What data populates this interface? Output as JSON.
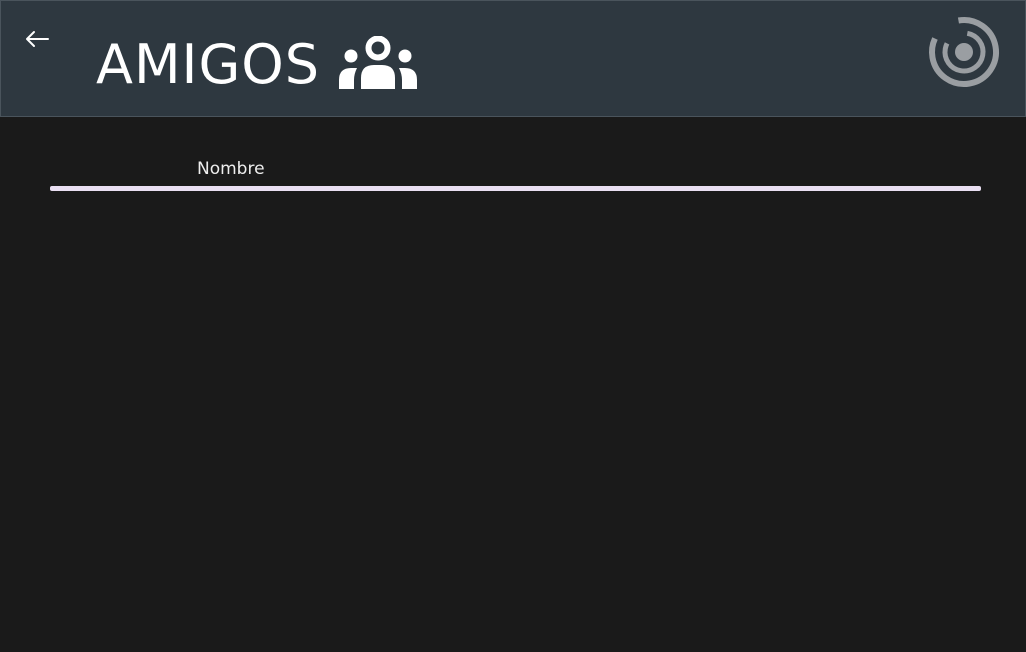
{
  "header": {
    "back_icon": "arrow-left-icon",
    "title": "AMIGOS",
    "title_icon": "users-group-icon",
    "logo_icon": "app-logo-icon",
    "background_color": "#2e3840",
    "text_color": "#ffffff"
  },
  "friends_table": {
    "columns": [
      "Nombre"
    ],
    "rows": [],
    "divider_color": "#e9dff2"
  },
  "page": {
    "background_color": "#1a1a1a"
  }
}
